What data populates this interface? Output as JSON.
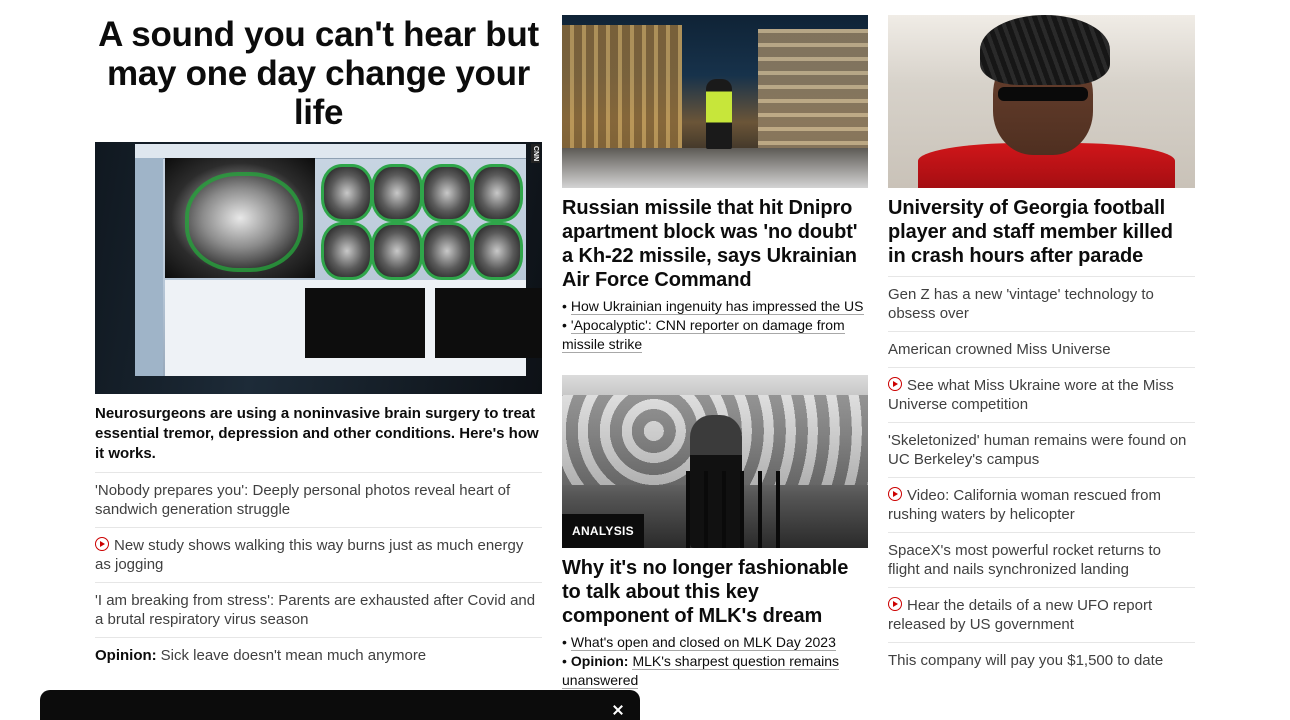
{
  "hero": {
    "title": "A sound you can't hear but may one day change your life",
    "image_badge": "CNN",
    "caption": "Neurosurgeons are using a noninvasive brain surgery to treat essential tremor, depression and other conditions. Here's how it works."
  },
  "left_list": [
    {
      "text": "'Nobody prepares you': Deeply personal photos reveal heart of sandwich generation struggle"
    },
    {
      "icon": "play-icon",
      "text": "New study shows walking this way burns just as much energy as jogging"
    },
    {
      "text": "'I am breaking from stress': Parents are exhausted after Covid and a brutal respiratory virus season"
    },
    {
      "prefix": "Opinion:",
      "text": "Sick leave doesn't mean much anymore"
    }
  ],
  "middle": {
    "story1": {
      "title": "Russian missile that hit Dnipro apartment block was 'no doubt' a Kh-22 missile, says Ukrainian Air Force Command",
      "links": [
        {
          "text": "How Ukrainian ingenuity has impressed the US"
        },
        {
          "text": "'Apocalyptic': CNN reporter on damage from missile strike"
        }
      ]
    },
    "story2": {
      "badge": "Analysis",
      "title": "Why it's no longer fashionable to talk about this key component of MLK's dream",
      "links": [
        {
          "text": "What's open and closed on MLK Day 2023"
        },
        {
          "prefix": "Opinion:",
          "text": "MLK's sharpest question remains unanswered"
        }
      ]
    }
  },
  "right": {
    "title": "University of Georgia football player and staff member killed in crash hours after parade",
    "list": [
      {
        "text": "Gen Z has a new 'vintage' technology to obsess over"
      },
      {
        "text": "American crowned Miss Universe"
      },
      {
        "icon": "play-icon",
        "text": "See what Miss Ukraine wore at the Miss Universe competition"
      },
      {
        "text": "'Skeletonized' human remains were found on UC Berkeley's campus"
      },
      {
        "icon": "play-icon",
        "text": "Video: California woman rescued from rushing waters by helicopter"
      },
      {
        "text": "SpaceX's most powerful rocket returns to flight and nails synchronized landing"
      },
      {
        "icon": "play-icon",
        "text": "Hear the details of a new UFO report released by US government"
      },
      {
        "text": "This company will pay you $1,500 to date"
      }
    ]
  },
  "colors": {
    "accent_red": "#cc0000",
    "text": "#0c0c0c",
    "muted": "#404040",
    "badge_bg": "#0c0c0c"
  }
}
